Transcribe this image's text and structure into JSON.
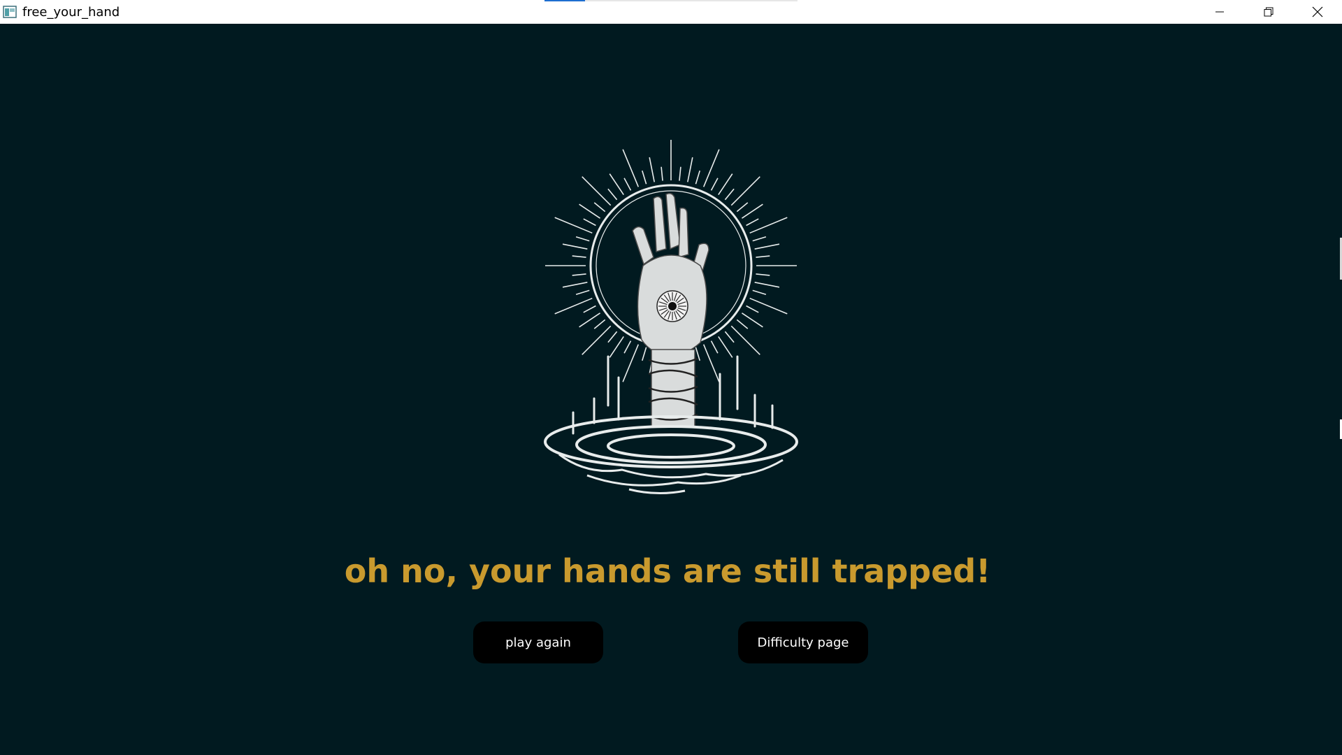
{
  "window": {
    "title": "free_your_hand",
    "progress": 0.16
  },
  "icons": {
    "app": "app-window-icon",
    "minimize": "minimize-icon",
    "maximize": "restore-icon",
    "close": "close-icon"
  },
  "art": {
    "subject": "hand-emerging-from-water-illustration"
  },
  "main": {
    "message": "oh no, your hands are still trapped!",
    "message_color": "#c99a2e",
    "background_color": "#011a20",
    "play_again_label": "play again",
    "difficulty_label": "Difficulty page"
  }
}
